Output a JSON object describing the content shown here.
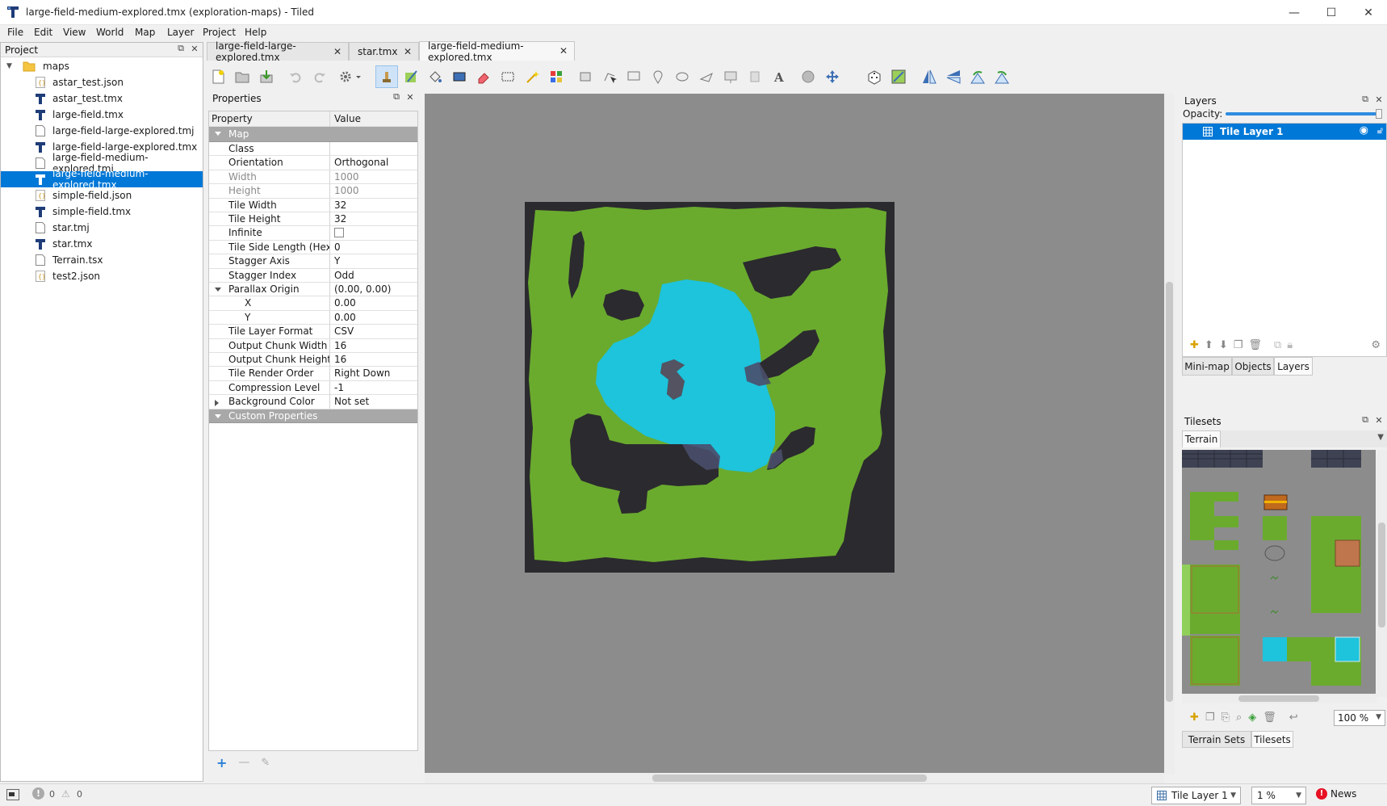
{
  "window": {
    "title": "large-field-medium-explored.tmx (exploration-maps) - Tiled",
    "minimize": "—",
    "maximize": "☐",
    "close": "✕"
  },
  "menu": [
    "File",
    "Edit",
    "View",
    "World",
    "Map",
    "Layer",
    "Project",
    "Help"
  ],
  "project": {
    "header": "Project",
    "root": "maps",
    "files": [
      {
        "name": "astar_test.json",
        "kind": "json"
      },
      {
        "name": "astar_test.tmx",
        "kind": "tmx"
      },
      {
        "name": "large-field.tmx",
        "kind": "tmx"
      },
      {
        "name": "large-field-large-explored.tmj",
        "kind": "tmj"
      },
      {
        "name": "large-field-large-explored.tmx",
        "kind": "tmx"
      },
      {
        "name": "large-field-medium-explored.tmj",
        "kind": "tmj"
      },
      {
        "name": "large-field-medium-explored.tmx",
        "kind": "tmx",
        "selected": true
      },
      {
        "name": "simple-field.json",
        "kind": "json"
      },
      {
        "name": "simple-field.tmx",
        "kind": "tmx"
      },
      {
        "name": "star.tmj",
        "kind": "tmj"
      },
      {
        "name": "star.tmx",
        "kind": "tmx"
      },
      {
        "name": "Terrain.tsx",
        "kind": "tmj"
      },
      {
        "name": "test2.json",
        "kind": "json"
      }
    ]
  },
  "tabs": [
    {
      "label": "large-field-large-explored.tmx"
    },
    {
      "label": "star.tmx"
    },
    {
      "label": "large-field-medium-explored.tmx",
      "active": true
    }
  ],
  "properties": {
    "header": "Properties",
    "col_property": "Property",
    "col_value": "Value",
    "group_map": "Map",
    "rows": [
      {
        "k": "Class",
        "v": ""
      },
      {
        "k": "Orientation",
        "v": "Orthogonal"
      },
      {
        "k": "Width",
        "v": "1000",
        "disabled": true
      },
      {
        "k": "Height",
        "v": "1000",
        "disabled": true
      },
      {
        "k": "Tile Width",
        "v": "32"
      },
      {
        "k": "Tile Height",
        "v": "32"
      },
      {
        "k": "Infinite",
        "v": "",
        "checkbox": true
      },
      {
        "k": "Tile Side Length (Hex)",
        "v": "0"
      },
      {
        "k": "Stagger Axis",
        "v": "Y"
      },
      {
        "k": "Stagger Index",
        "v": "Odd"
      },
      {
        "k": "Parallax Origin",
        "v": "(0.00, 0.00)",
        "expand": "down"
      },
      {
        "k": "X",
        "v": "0.00",
        "indent": true
      },
      {
        "k": "Y",
        "v": "0.00",
        "indent": true
      },
      {
        "k": "Tile Layer Format",
        "v": "CSV"
      },
      {
        "k": "Output Chunk Width",
        "v": "16"
      },
      {
        "k": "Output Chunk Height",
        "v": "16"
      },
      {
        "k": "Tile Render Order",
        "v": "Right Down"
      },
      {
        "k": "Compression Level",
        "v": "-1"
      },
      {
        "k": "Background Color",
        "v": "Not set",
        "expand": "right"
      }
    ],
    "group_custom": "Custom Properties"
  },
  "layers": {
    "header": "Layers",
    "opacity_label": "Opacity:",
    "opacity": 1.0,
    "items": [
      {
        "name": "Tile Layer 1",
        "visible": true
      }
    ],
    "tabs": [
      "Mini-map",
      "Objects",
      "Layers"
    ],
    "active_tab": "Layers"
  },
  "tilesets": {
    "header": "Tilesets",
    "tab": "Terrain",
    "zoom": "100 %",
    "bottom_tabs": [
      "Terrain Sets",
      "Tilesets"
    ]
  },
  "status": {
    "errors": "0",
    "warnings": "0",
    "layer": "Tile Layer 1",
    "zoom": "1 %",
    "news": "News"
  },
  "colors": {
    "grass": "#6aab2e",
    "water": "#1ec3dc",
    "rock": "#2b2a2e",
    "selection": "#0078d7"
  }
}
